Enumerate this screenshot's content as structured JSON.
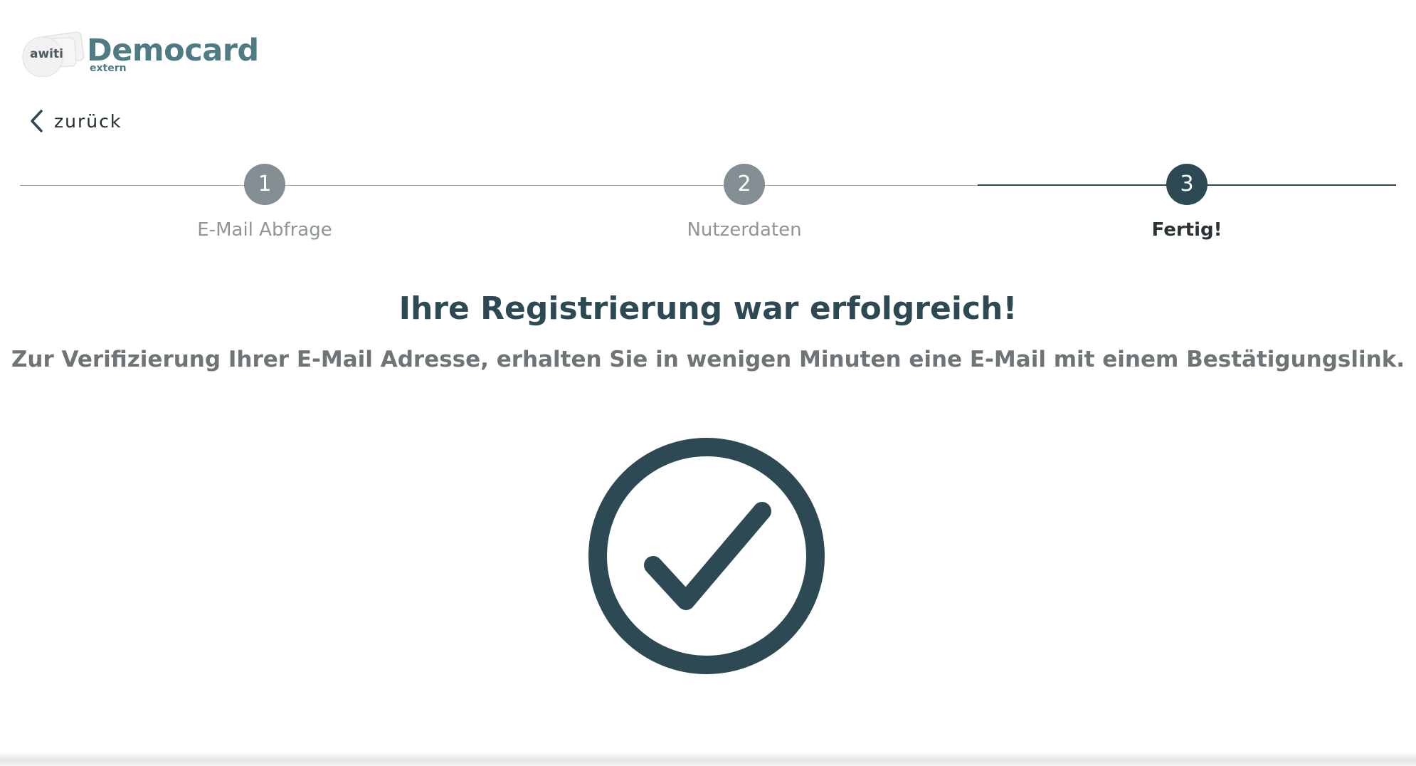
{
  "logo": {
    "brand": "awiti",
    "title": "Democard",
    "subtitle": "extern"
  },
  "nav": {
    "back_label": "zurück",
    "back_icon": "chevron-left-icon"
  },
  "stepper": {
    "steps": [
      {
        "number": "1",
        "label": "E-Mail Abfrage",
        "state": "complete"
      },
      {
        "number": "2",
        "label": "Nutzerdaten",
        "state": "complete"
      },
      {
        "number": "3",
        "label": "Fertig!",
        "state": "active"
      }
    ]
  },
  "main": {
    "headline": "Ihre Registrierung war erfolgreich!",
    "message": "Zur Verifizierung Ihrer E-Mail Adresse, erhalten Sie in wenigen Minuten eine E-Mail mit einem Bestätigungslink.",
    "status_icon": "check-circle-icon"
  },
  "colors": {
    "primary": "#2d4a54",
    "brand": "#4e7b84",
    "step_inactive": "#848f93",
    "text_muted": "#8e9698",
    "text_secondary": "#6f7577"
  }
}
